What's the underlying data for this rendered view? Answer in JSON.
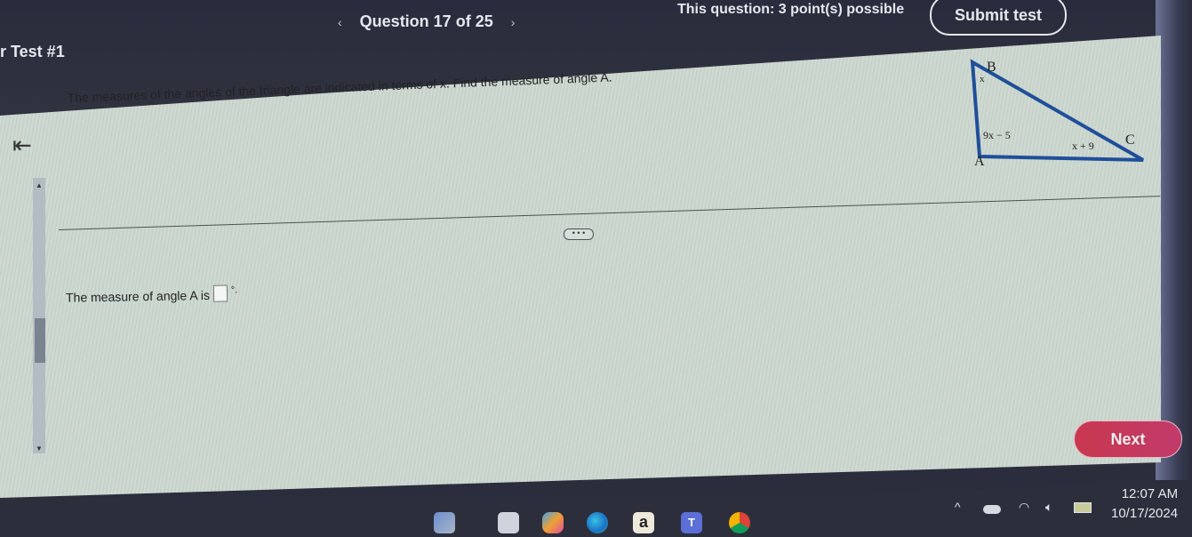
{
  "header": {
    "test_title": "r Test #1",
    "question_label": "Question 17 of 25",
    "prev_icon": "‹",
    "next_icon": "›",
    "points_text": "This question: 3 point(s) possible",
    "submit_label": "Submit test"
  },
  "nav": {
    "back_icon": "⇤"
  },
  "question": {
    "prompt": "The measures of the angles of the triangle are indicated in terms of x. Find the measure of angle A.",
    "figure": {
      "vertices": [
        "A",
        "B",
        "C"
      ],
      "angle_labels": {
        "A": "9x − 5",
        "B": "x",
        "C": "x + 9"
      },
      "stroke_color": "#1f4f9a"
    },
    "more_label": "• • •",
    "answer_prefix": "The measure of angle A is",
    "answer_value": "",
    "answer_suffix": "°."
  },
  "footer": {
    "next_label": "Next",
    "next_color": "#c8384f"
  },
  "taskbar": {
    "apps": [
      "widgets",
      "file-explorer",
      "copilot",
      "edge",
      "amazon",
      "teams",
      "chrome"
    ],
    "amazon_glyph": "a",
    "teams_glyph": "T",
    "tray": {
      "chevron": "^",
      "time": "12:07 AM",
      "date": "10/17/2024"
    }
  }
}
